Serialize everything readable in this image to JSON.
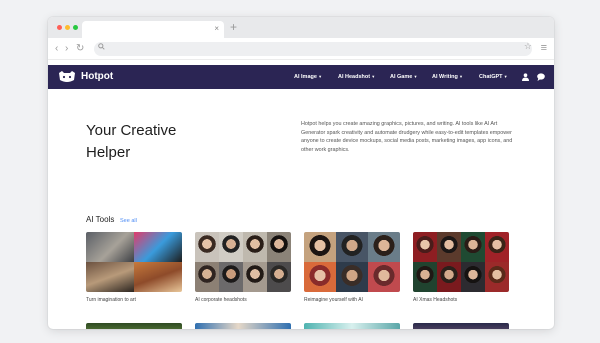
{
  "browser": {
    "traffic_lights": [
      "#ff5f57",
      "#febc2e",
      "#28c840"
    ],
    "tab_close": "×",
    "new_tab": "+",
    "nav_icons": {
      "back": "‹",
      "forward": "›",
      "reload": "↻"
    },
    "star": "☆",
    "menu": "≡"
  },
  "site": {
    "brand": "Hotpot",
    "nav": [
      {
        "label": "AI Image"
      },
      {
        "label": "AI Headshot"
      },
      {
        "label": "AI Game"
      },
      {
        "label": "AI Writing"
      },
      {
        "label": "ChatGPT"
      }
    ],
    "caret": "▾",
    "colors": {
      "nav_bg": "#2b2554",
      "link": "#4c8bf5"
    }
  },
  "hero": {
    "title_line1": "Your Creative",
    "title_line2": "Helper",
    "description": "Hotpot helps you create amazing graphics, pictures, and writing. AI tools like AI Art Generator spark creativity and automate drudgery while easy-to-edit templates empower anyone to create device mockups, social media posts, marketing images, app icons, and other work graphics."
  },
  "tools": {
    "title": "AI Tools",
    "see_all": "See all",
    "cards": [
      {
        "caption": "Turn imagination to art"
      },
      {
        "caption": "AI corporate headshots"
      },
      {
        "caption": "Reimagine yourself with AI"
      },
      {
        "caption": "AI Xmas Headshots"
      }
    ]
  }
}
